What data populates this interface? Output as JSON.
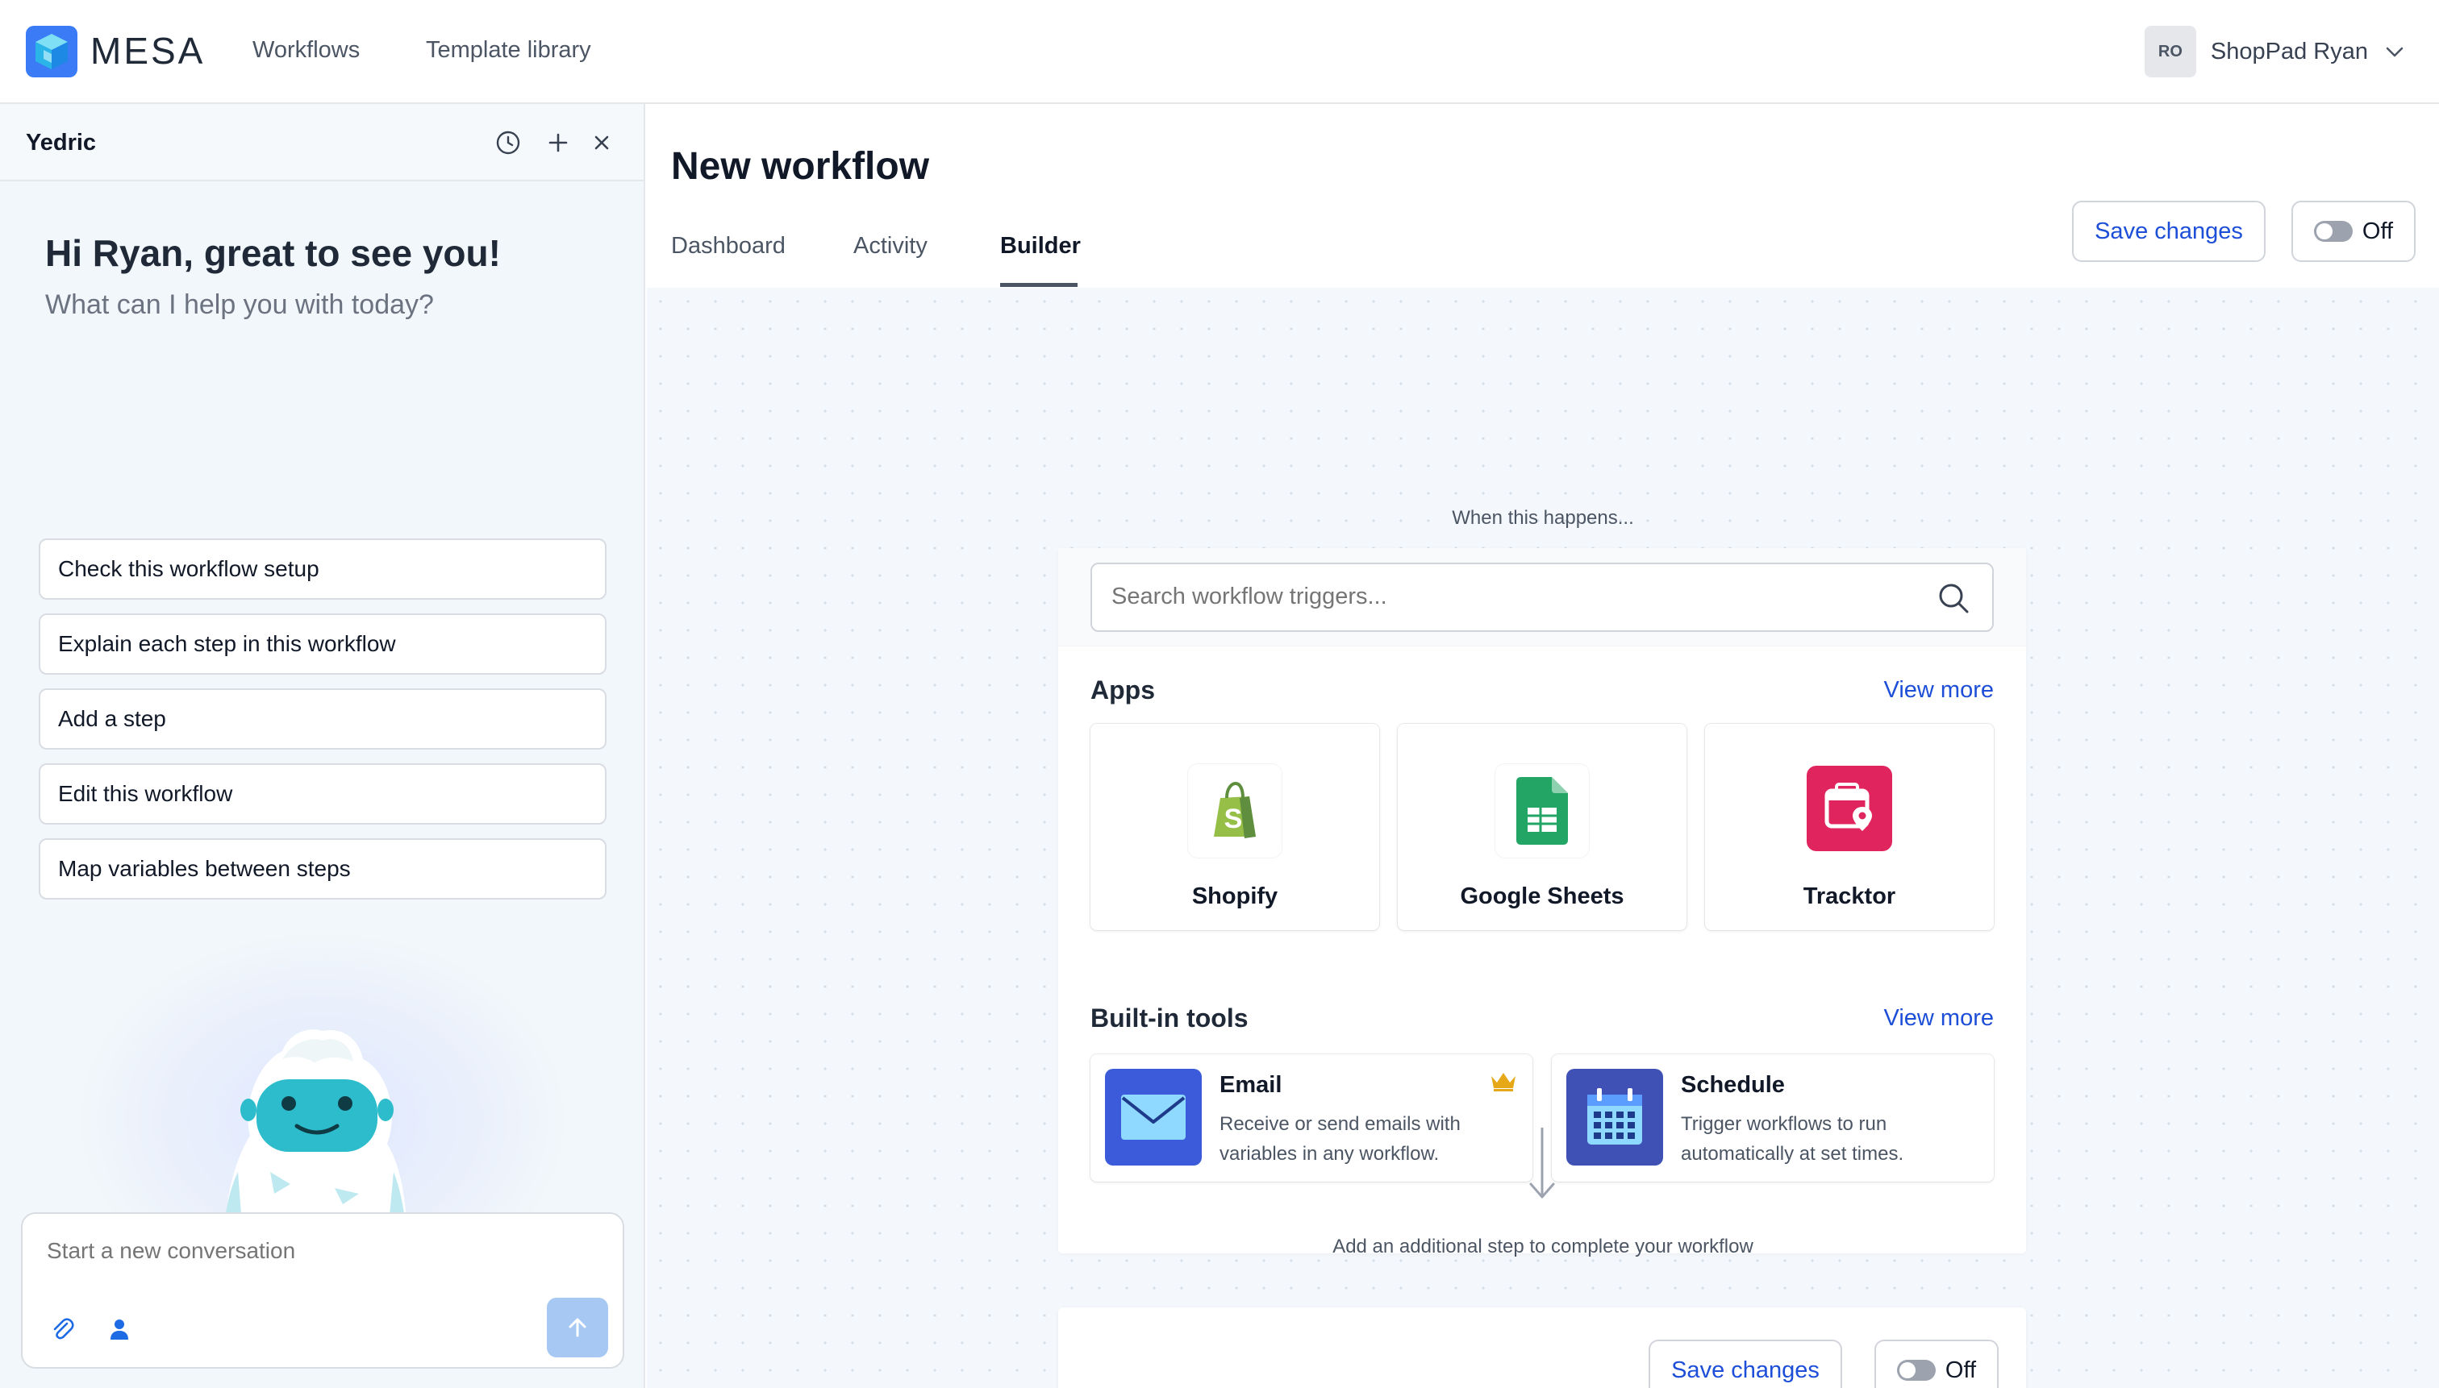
{
  "brand": {
    "name": "MESA"
  },
  "nav": {
    "items": [
      "Workflows",
      "Template library"
    ]
  },
  "user": {
    "initials": "RO",
    "name": "ShopPad Ryan"
  },
  "assistant": {
    "title": "Yedric",
    "greeting": "Hi Ryan, great to see you!",
    "subtitle": "What can I help you with today?",
    "suggestions": [
      "Check this workflow setup",
      "Explain each step in this workflow",
      "Add a step",
      "Edit this workflow",
      "Map variables between steps"
    ],
    "composer_placeholder": "Start a new conversation"
  },
  "workflow": {
    "title": "New workflow",
    "tabs": [
      "Dashboard",
      "Activity",
      "Builder"
    ],
    "active_tab": "Builder",
    "save_label": "Save changes",
    "toggle_label": "Off"
  },
  "trigger": {
    "heading": "When this happens...",
    "search_placeholder": "Search workflow triggers...",
    "apps_title": "Apps",
    "view_more": "View more",
    "apps": [
      {
        "name": "Shopify",
        "icon": "shopify-icon"
      },
      {
        "name": "Google Sheets",
        "icon": "google-sheets-icon"
      },
      {
        "name": "Tracktor",
        "icon": "tracktor-icon"
      }
    ],
    "tools_title": "Built-in tools",
    "tools": [
      {
        "name": "Email",
        "description": "Receive or send emails with variables in any workflow.",
        "icon": "envelope-icon",
        "premium": true
      },
      {
        "name": "Schedule",
        "description": "Trigger workflows to run automatically at set times.",
        "icon": "calendar-icon",
        "premium": false
      }
    ],
    "additional_step": "Add an additional step to complete your workflow"
  },
  "colors": {
    "accent": "#1d4ed8",
    "shopify": "#95bf47",
    "sheets": "#23a566",
    "tracktor": "#e0245e",
    "email": "#3b5bdb",
    "schedule": "#3f51b5",
    "crown": "#e6a817"
  }
}
